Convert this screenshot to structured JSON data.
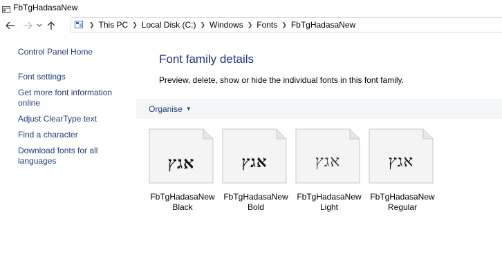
{
  "window": {
    "title": "FbTgHadasaNew"
  },
  "nav": {
    "back_icon": "back-arrow-icon",
    "forward_icon": "forward-arrow-icon",
    "recent_icon": "chevron-down-icon",
    "up_icon": "up-arrow-icon"
  },
  "breadcrumb": {
    "items": [
      "This PC",
      "Local Disk (C:)",
      "Windows",
      "Fonts",
      "FbTgHadasaNew"
    ]
  },
  "sidebar": {
    "items": [
      {
        "label": "Control Panel Home"
      },
      {
        "label": "Font settings"
      },
      {
        "label": "Get more font information online"
      },
      {
        "label": "Adjust ClearType text"
      },
      {
        "label": "Find a character"
      },
      {
        "label": "Download fonts for all languages"
      }
    ]
  },
  "main": {
    "title": "Font family details",
    "description": "Preview, delete, show or hide the individual fonts in this font family."
  },
  "toolbar": {
    "organise_label": "Organise"
  },
  "fonts": [
    {
      "sample": "אגץ",
      "name_line1": "FbTgHadasaNew",
      "name_line2": "Black"
    },
    {
      "sample": "אגץ",
      "name_line1": "FbTgHadasaNew",
      "name_line2": "Bold"
    },
    {
      "sample": "אגץ",
      "name_line1": "FbTgHadasaNew",
      "name_line2": "Light"
    },
    {
      "sample": "אגץ",
      "name_line1": "FbTgHadasaNew",
      "name_line2": "Regular"
    }
  ],
  "colors": {
    "link": "#1e3e7b",
    "title": "#1e3287",
    "commandbar": "#f5f6f7"
  }
}
